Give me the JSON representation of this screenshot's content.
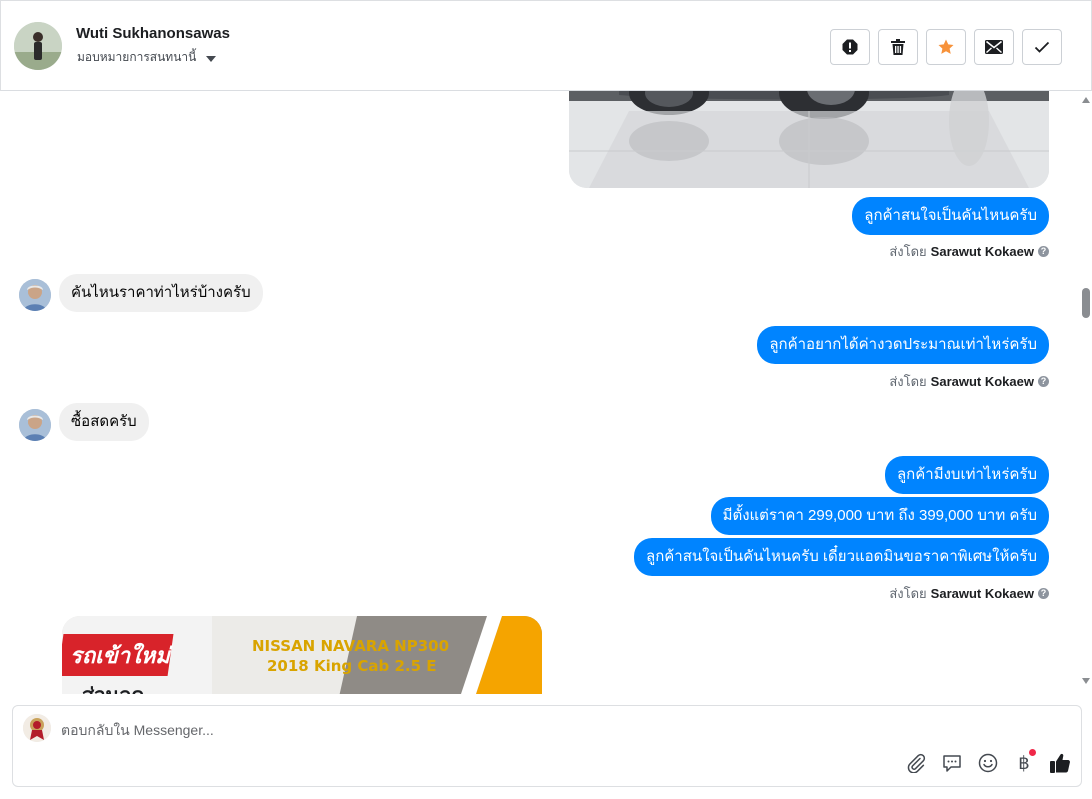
{
  "header": {
    "name": "Wuti Sukhanonsawas",
    "assign_label": "มอบหมายการสนทนานี้",
    "actions": [
      {
        "name": "spam-icon"
      },
      {
        "name": "trash-icon"
      },
      {
        "name": "star-icon"
      },
      {
        "name": "envelope-icon"
      },
      {
        "name": "check-icon"
      }
    ]
  },
  "colors": {
    "accent": "#0084ff",
    "star": "#f7923a",
    "incoming_bubble": "#f0f0f0"
  },
  "messages": {
    "m1": "ลูกค้าสนใจเป็นคันไหนครับ",
    "in1": "คันไหนราคาท่าไหร่บ้างครับ",
    "m2": "ลูกค้าอยากได้ค่างวดประมาณเท่าไหร่ครับ",
    "in2": "ซื้อสดครับ",
    "m3": "ลูกค้ามีงบเท่าไหร่ครับ",
    "m4": "มีตั้งแต่ราคา 299,000 บาท ถึง 399,000 บาท ครับ",
    "m5": "ลูกค้าสนใจเป็นคันไหนครับ เดี๋ยวแอดมินขอราคาพิเศษให้ครับ"
  },
  "sent_by": {
    "prefix": "ส่งโดย",
    "agent": "Sarawut Kokaew",
    "help": "?"
  },
  "promo_image": {
    "badge": "รถเข้าใหม่",
    "line1": "NISSAN NAVARA NP300",
    "line2": "2018 King Cab 2.5 E",
    "partial": "ส่วนลด"
  },
  "composer": {
    "placeholder": "ตอบกลับใน Messenger...",
    "tools": [
      "paperclip-icon",
      "saved-reply-icon",
      "emoji-icon",
      "baht-icon",
      "like-icon"
    ],
    "baht_symbol": "฿"
  }
}
